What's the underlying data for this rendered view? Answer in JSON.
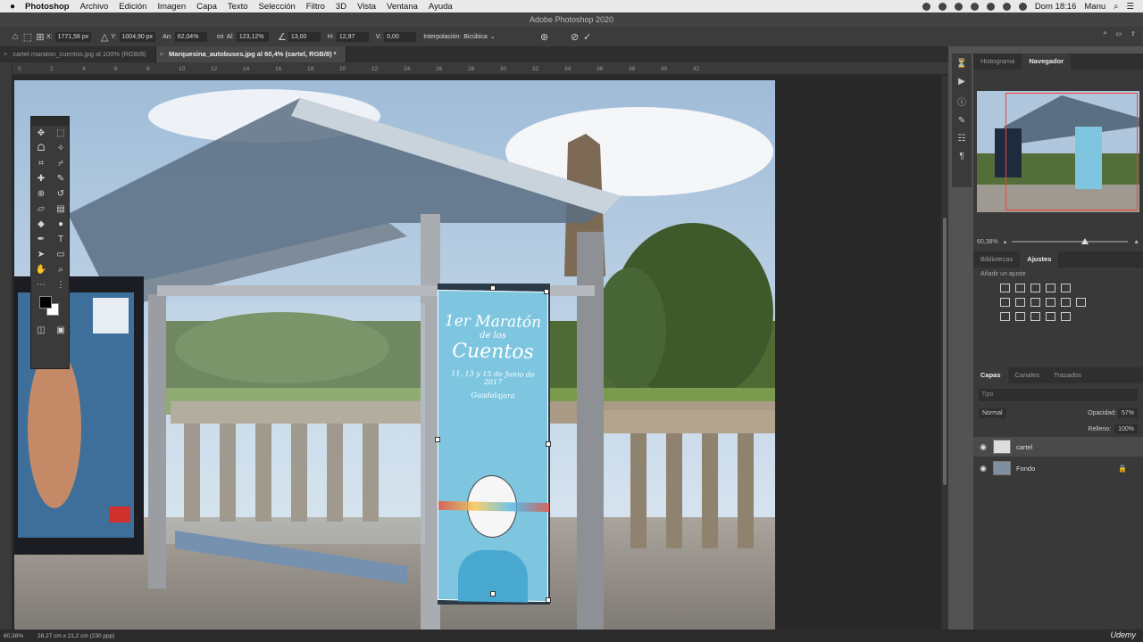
{
  "menubar": {
    "apple": "",
    "app": "Photoshop",
    "items": [
      "Archivo",
      "Edición",
      "Imagen",
      "Capa",
      "Texto",
      "Selección",
      "Filtro",
      "3D",
      "Vista",
      "Ventana",
      "Ayuda"
    ],
    "clock": "Dom 18:16",
    "user": "Manu"
  },
  "titlebar": {
    "title": "Adobe Photoshop 2020"
  },
  "optionsbar": {
    "x_label": "X:",
    "x_value": "1771,58 px",
    "y_label": "Y:",
    "y_value": "1004,90 px",
    "w_label": "An:",
    "w_value": "62,04%",
    "h_label": "Al:",
    "h_value": "123,12%",
    "angle_value": "13,00",
    "hskew_label": "H:",
    "hskew_value": "12,97",
    "vskew_label": "V:",
    "vskew_value": "0,00",
    "interp_label": "Interpolación:",
    "interp_value": "Bicúbica"
  },
  "tabs": [
    {
      "label": "cartel maraton_cuentos.jpg al 100% (RGB/8)",
      "active": false
    },
    {
      "label": "Marquesina_autobuses.jpg al 60,4% (cartel, RGB/8) *",
      "active": true
    }
  ],
  "ruler_ticks": [
    "0",
    "2",
    "4",
    "6",
    "8",
    "10",
    "12",
    "14",
    "16",
    "18",
    "20",
    "22",
    "24",
    "26",
    "28",
    "30",
    "32",
    "34",
    "36",
    "38",
    "40",
    "42"
  ],
  "poster": {
    "title_1": "1er Maratón",
    "title_2": "de los",
    "title_3": "Cuentos",
    "dates": "11, 13 y 15 de Junio de 2017",
    "place": "Guadalajara"
  },
  "panels": {
    "top_tabs": [
      "Histograma",
      "Navegador"
    ],
    "zoom_value": "60,38%",
    "mid_tabs": [
      "Bibliotecas",
      "Ajustes"
    ],
    "adjust_title": "Añadir un ajuste",
    "layers_tabs": [
      "Capas",
      "Canales",
      "Trazados"
    ],
    "search_placeholder": "Tipo",
    "blend_mode": "Normal",
    "opacity_label": "Opacidad:",
    "opacity_value": "57%",
    "fill_label": "Relleno:",
    "fill_value": "100%",
    "layers": [
      {
        "name": "cartel",
        "locked": false
      },
      {
        "name": "Fondo",
        "locked": true
      }
    ]
  },
  "statusbar": {
    "zoom": "60,38%",
    "docsize": "28,27 cm x 21,2 cm (230 ppp)",
    "brand": "Udemy"
  }
}
